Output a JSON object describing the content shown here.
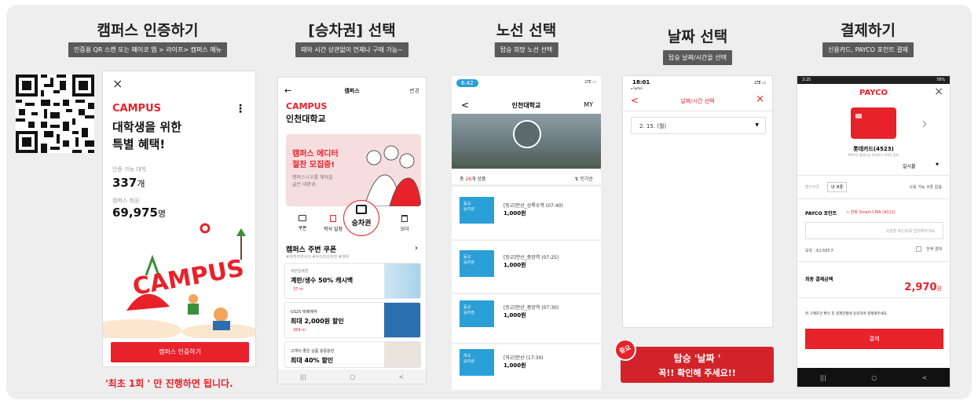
{
  "steps": [
    {
      "title": "캠퍼스 인증하기",
      "subtitle": "인증용 QR 스캔 또는 페이코 앱 > 라이프> 캠퍼스 메뉴"
    },
    {
      "title": "[승차권] 선택",
      "subtitle": "때와 시간 상관없이 언제나 구매 가능~"
    },
    {
      "title": "노선 선택",
      "subtitle": "탑승 희망 노선 선택"
    },
    {
      "title": "날짜 선택",
      "subtitle": "탑승 날짜/시간을 선택"
    },
    {
      "title": "결제하기",
      "subtitle": "신용카드, PAYCO 포인트 결제"
    }
  ],
  "screen1": {
    "close": "×",
    "brand": "CAMPUS",
    "headline1": "대학생을 위한",
    "headline2": "특별 혜택!",
    "more": "⋮",
    "univ_label": "인증 가능 대학",
    "univ_count": "337",
    "univ_unit": "개",
    "member_label": "캠퍼스 회원",
    "member_count": "69,975",
    "member_unit": "명",
    "illustration_text": "CAMPUS",
    "cta": "캠퍼스 인증하기"
  },
  "note1": "'최초 1회 ' 만 진행하면 됩니다.",
  "screen2": {
    "back": "←",
    "header_title": "캠퍼스",
    "header_right": "변경",
    "brand": "CAMPUS",
    "school": "인천대학교",
    "banner_title1": "캠퍼스 에디터",
    "banner_title2": "절찬 모집중!",
    "banner_sub1": "캠퍼스나우를 채워갈",
    "banner_sub2": "글쓴 대환영.",
    "menu": [
      {
        "icon": "coupon-icon",
        "label": "쿠폰"
      },
      {
        "icon": "meal-icon",
        "label": "학식 일정"
      },
      {
        "icon": "ticket-icon",
        "label": "승차권"
      },
      {
        "icon": "cup-icon",
        "label": "오더"
      }
    ],
    "section_title": "캠퍼스 주변 쿠폰",
    "section_tags": "#뭐먹지뭐사지 #우리학교주변 #대박",
    "coupons": [
      {
        "store": "세븐일레븐",
        "title": "계란/생수 50% 캐시백",
        "dist": "37 m"
      },
      {
        "store": "GS25 택배예약",
        "title": "최대 2,000원 할인",
        "dist": "269 m"
      },
      {
        "store": "고객이 좋은 상품 왕중왕전",
        "title": "최대 40% 할인",
        "dist": ""
      }
    ],
    "nav": [
      "|||",
      "○",
      "<"
    ]
  },
  "screen3": {
    "time": "6:42",
    "status": "LTE",
    "back": "<",
    "title": "인천대학교",
    "right": "MY",
    "count_prefix": "총 ",
    "count": "26",
    "count_suffix": "개 상품",
    "sort": "인기순",
    "routes": [
      {
        "badge1": "등교",
        "badge2": "승차권",
        "name": "[등교]안산_상록수역 (07:40)",
        "price": "1,000원"
      },
      {
        "badge1": "등교",
        "badge2": "승차권",
        "name": "[등교]안산_중앙역 (07:25)",
        "price": "1,000원"
      },
      {
        "badge1": "등교",
        "badge2": "승차권",
        "name": "[등교]안산_중앙역 (07:30)",
        "price": "1,000원"
      },
      {
        "badge1": "하교",
        "badge2": "승차권",
        "name": "[하교]안산 (17:30)",
        "price": "1,000원"
      }
    ]
  },
  "screen4": {
    "time": "18:01",
    "back_app": "◂ Safari",
    "status": "LTE",
    "back": "<",
    "title": "날짜/시간 선택",
    "close": "×",
    "date": "2. 15. (월)"
  },
  "note4": {
    "badge": "중요",
    "line1": "탑승 '날짜 '",
    "line2": "꼭!! 확인해 주세요!!"
  },
  "screen5": {
    "status_time": "3:25",
    "battery": "78%",
    "brand": "PAYCO",
    "close": "×",
    "card_name": "롯데카드(4523)",
    "card_sub": "PAYCO 플래티넘 롯데카드 VISA_법자",
    "installment": "일시불",
    "coupon_label": "할인쿠폰",
    "coupon_btn": "내 쿠폰",
    "coupon_none": "사용 가능 쿠폰 없음",
    "point_label": "PAYCO 포인트",
    "point_link": "한화 Smart CMA (9011)",
    "point_placeholder": "사용할 포인트를 입력해주세요.",
    "balance": "보유 : 62,685 P",
    "use_all": "전액 결제",
    "total_label": "최종 결제금액",
    "total": "2,970",
    "total_unit": "원",
    "agree": "위 구매조건 확인 후 결제진행에 동의하며 결제해주세요.",
    "pay_btn": "결제",
    "nav": [
      "|||",
      "○",
      "<"
    ]
  },
  "colors": {
    "accent": "#e8222b",
    "route_badge": "#2a9fd8",
    "frame": "#eeeeee",
    "label": "#5a5a5a"
  }
}
